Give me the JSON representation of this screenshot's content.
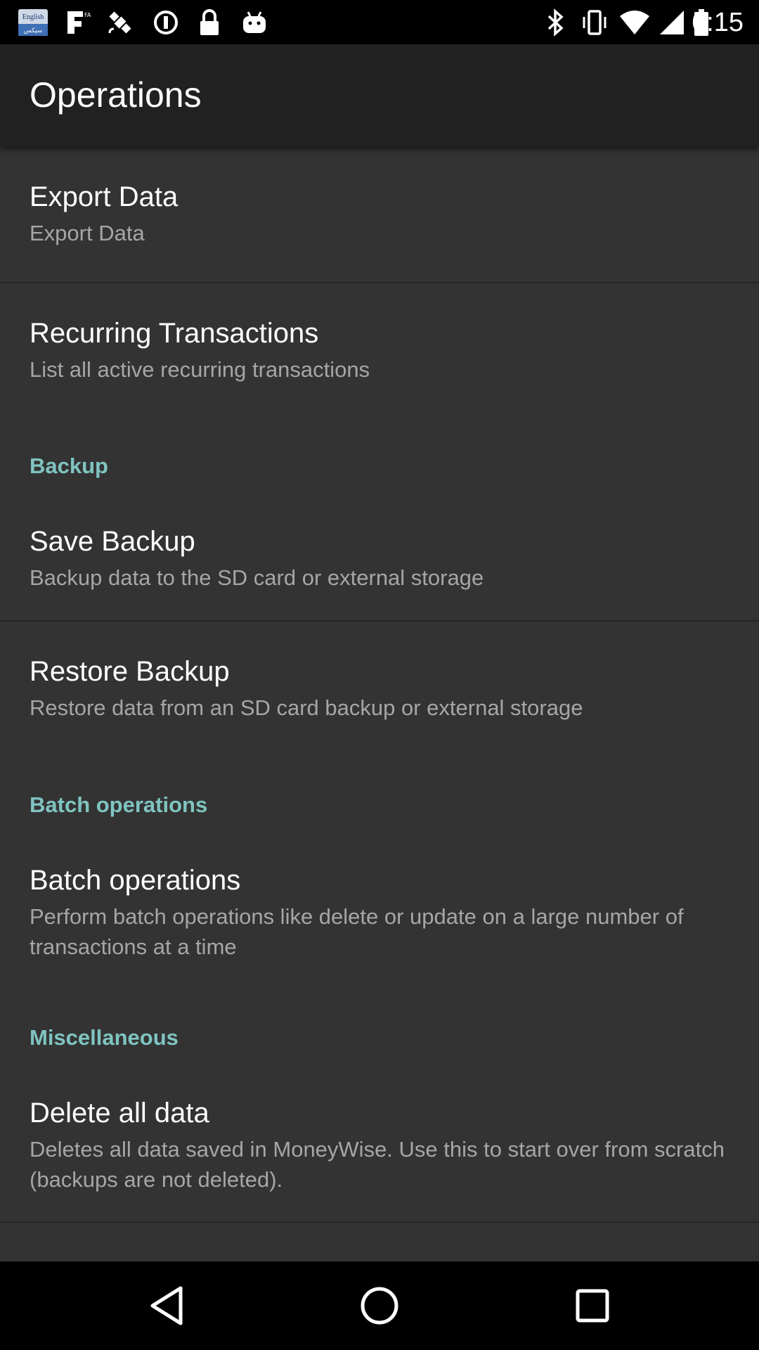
{
  "status_bar": {
    "time": "6:15",
    "left_icons": [
      "english-keyboard-icon",
      "fake-gps-icon",
      "satellite-icon",
      "sync-icon",
      "lock-icon",
      "android-icon"
    ],
    "right_icons": [
      "bluetooth-icon",
      "vibrate-icon",
      "wifi-icon",
      "signal-icon",
      "battery-icon"
    ],
    "keyboard_badge_top": "English",
    "keyboard_badge_bottom": "سيكس"
  },
  "app_bar": {
    "title": "Operations"
  },
  "items": [
    {
      "title": "Export Data",
      "subtitle": "Export Data"
    },
    {
      "title": "Recurring Transactions",
      "subtitle": "List all active recurring transactions"
    },
    {
      "title": "Save Backup",
      "subtitle": "Backup data to the SD card or external storage"
    },
    {
      "title": "Restore Backup",
      "subtitle": "Restore data from an SD card backup or external storage"
    },
    {
      "title": "Batch operations",
      "subtitle": "Perform batch operations like delete or update on a large number of transactions at a time"
    },
    {
      "title": "Delete all data",
      "subtitle": "Deletes all data saved in MoneyWise. Use this to start over from scratch (backups are not deleted)."
    }
  ],
  "categories": {
    "backup": "Backup",
    "batch": "Batch operations",
    "misc": "Miscellaneous"
  },
  "nav_bar": {
    "icons": [
      "back-icon",
      "home-icon",
      "recents-icon"
    ]
  },
  "colors": {
    "accent": "#7fc4c1",
    "background": "#333333",
    "app_bar": "#212121",
    "title_text": "#ffffff",
    "subtitle_text": "#a6a6a6"
  }
}
